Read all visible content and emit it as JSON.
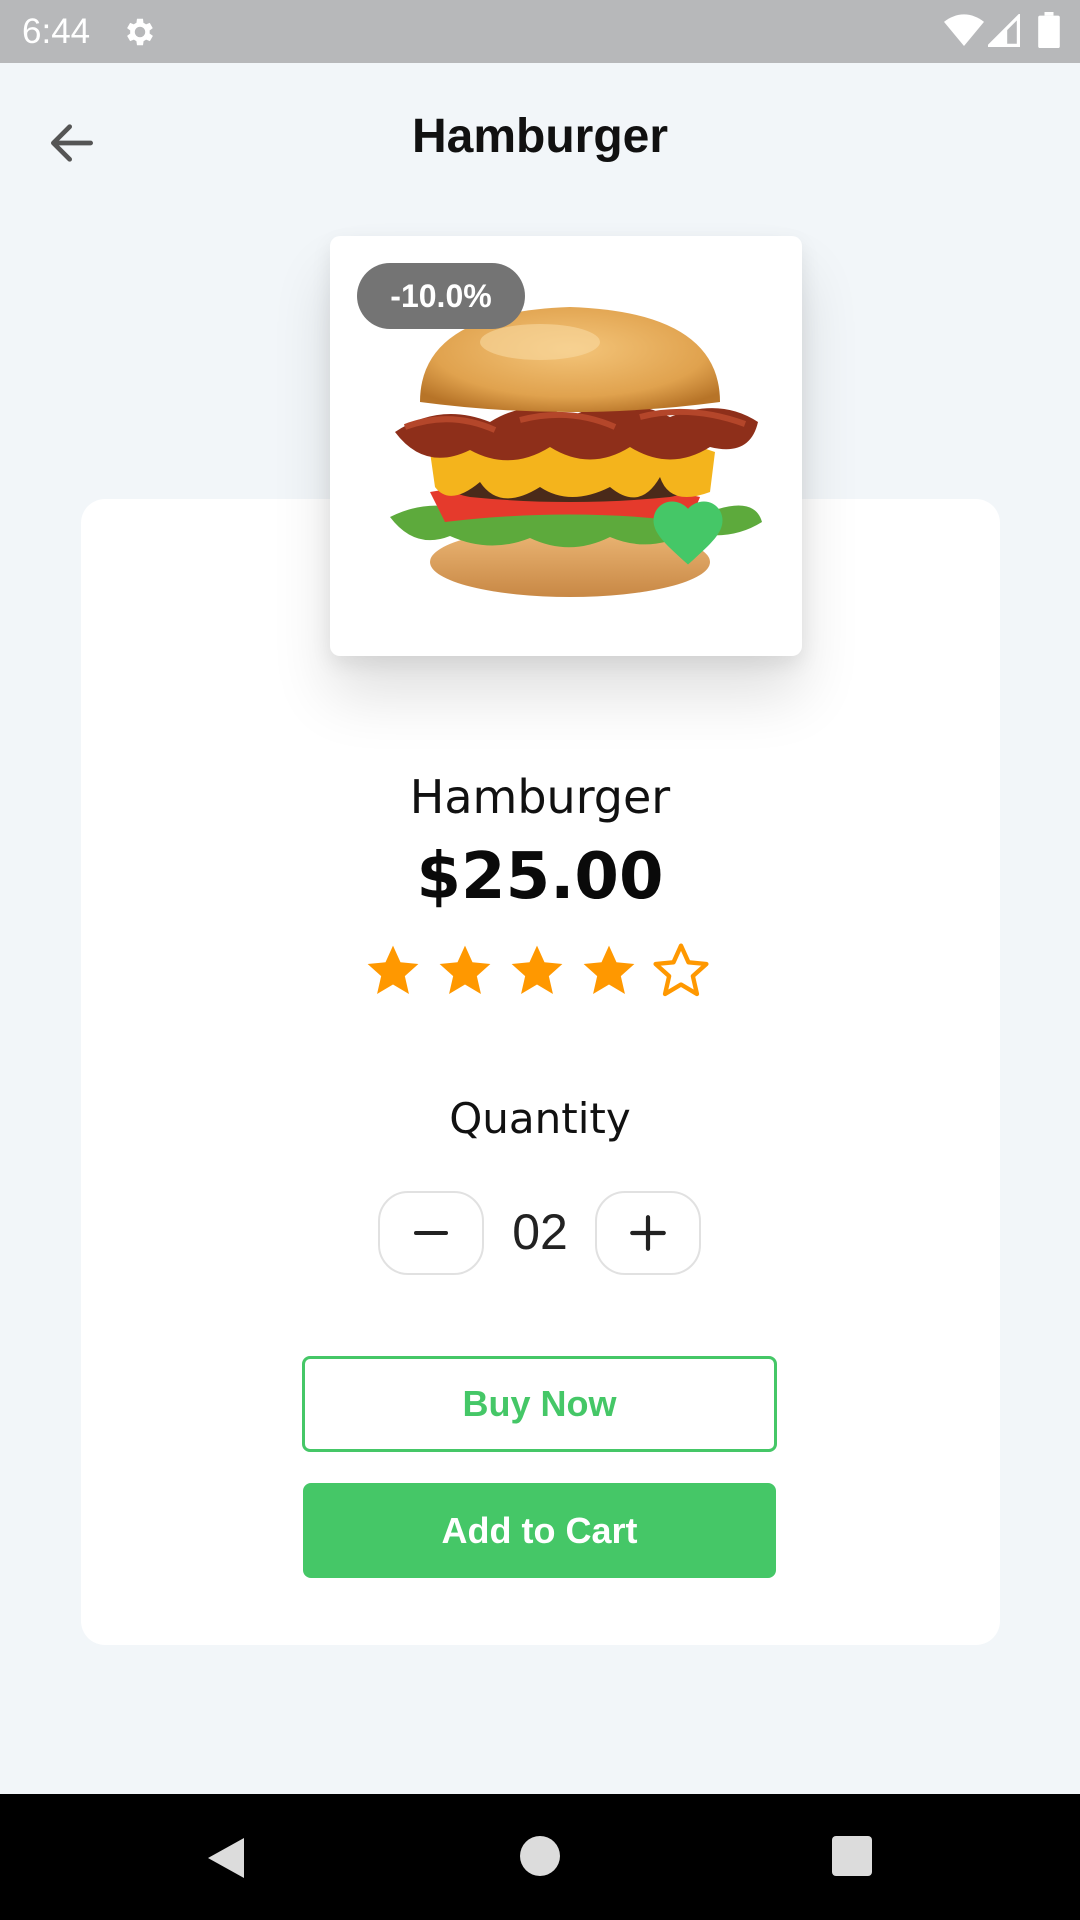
{
  "status_bar": {
    "time": "6:44",
    "icons": [
      "gear-icon",
      "wifi-icon",
      "signal-icon",
      "battery-icon"
    ]
  },
  "app_bar": {
    "title": "Hamburger",
    "back_icon": "arrow-left-icon"
  },
  "product": {
    "discount": "-10.0%",
    "name": "Hamburger",
    "price": "$25.00",
    "rating": 4,
    "rating_max": 5,
    "favorite": true,
    "favorite_color": "#45C767"
  },
  "quantity": {
    "label": "Quantity",
    "value": "02",
    "decrement_icon": "minus-icon",
    "increment_icon": "plus-icon"
  },
  "actions": {
    "buy_now": "Buy Now",
    "add_to_cart": "Add to Cart"
  },
  "colors": {
    "accent": "#45C767",
    "star": "#FF9800",
    "badge": "#747474",
    "background": "#F2F6F9"
  },
  "nav_bar": {
    "icons": [
      "nav-back-icon",
      "nav-home-icon",
      "nav-recents-icon"
    ]
  }
}
